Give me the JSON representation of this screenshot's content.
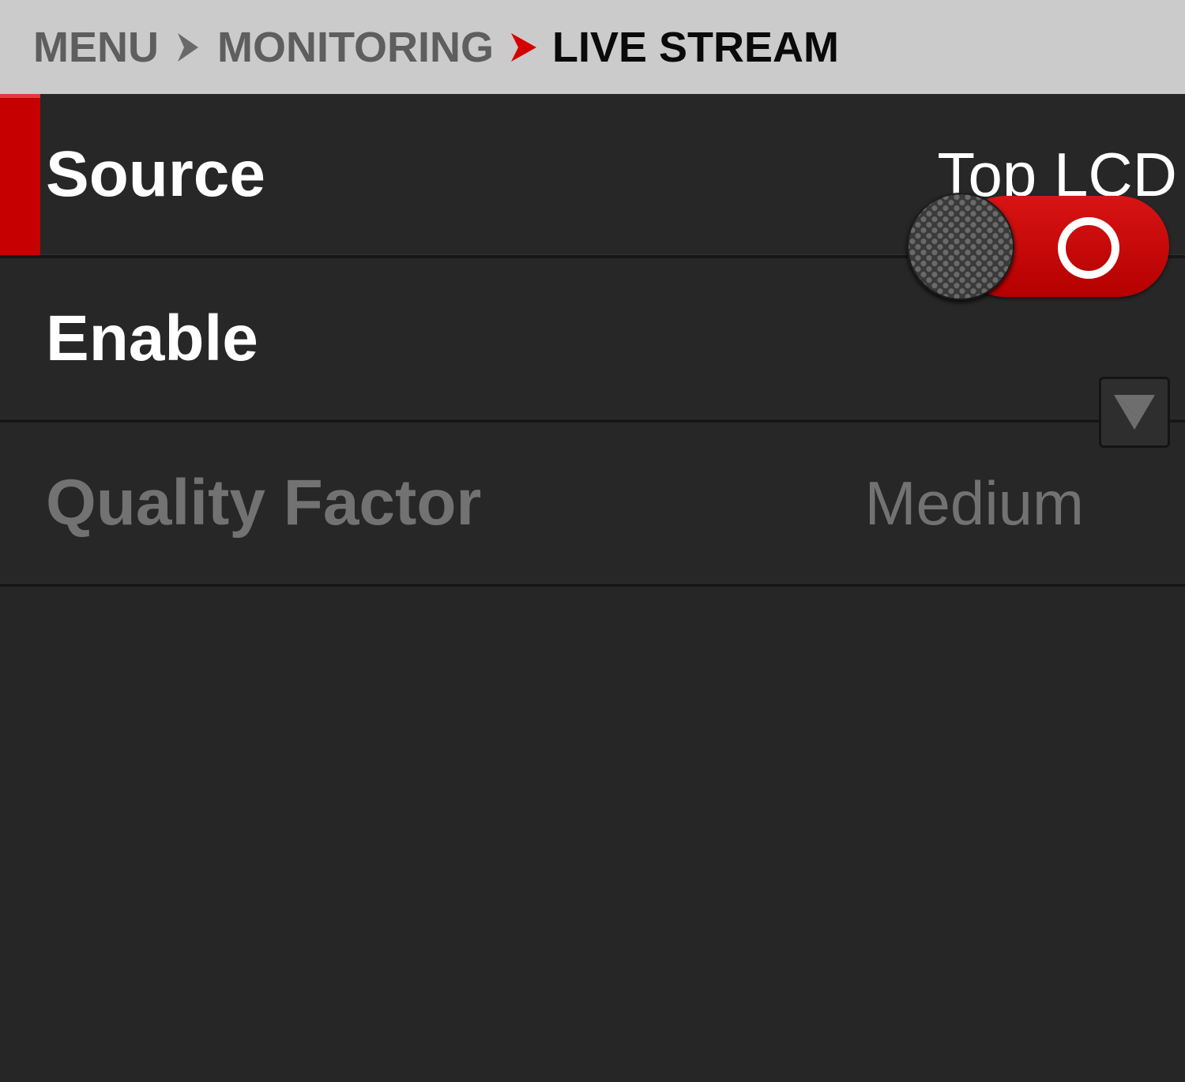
{
  "breadcrumb": {
    "items": [
      "MENU",
      "MONITORING",
      "LIVE STREAM"
    ]
  },
  "settings": {
    "source": {
      "label": "Source",
      "value": "Top LCD"
    },
    "enable": {
      "label": "Enable",
      "state": "on"
    },
    "quality_factor": {
      "label": "Quality Factor",
      "value": "Medium",
      "disabled": true
    }
  },
  "colors": {
    "accent": "#c60000",
    "background": "#262626",
    "breadcrumb_bg": "#cbcbcb",
    "disabled_text": "#727272"
  },
  "icons": [
    "chevron-right-icon",
    "chevron-right-red-icon",
    "chevron-down-icon"
  ]
}
